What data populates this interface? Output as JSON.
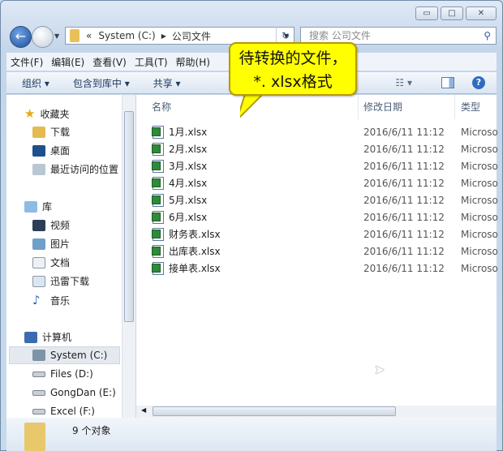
{
  "window": {
    "controls": [
      "minimize",
      "maximize",
      "close"
    ]
  },
  "address": {
    "chevron": "«",
    "crumbs": [
      "System (C:)",
      "公司文件"
    ]
  },
  "search": {
    "placeholder": "搜索 公司文件"
  },
  "menu": [
    "文件(F)",
    "编辑(E)",
    "查看(V)",
    "工具(T)",
    "帮助(H)"
  ],
  "toolbar": {
    "organize": "组织",
    "include": "包含到库中",
    "share": "共享"
  },
  "nav": {
    "favorites": "收藏夹",
    "fav_items": [
      "下载",
      "桌面",
      "最近访问的位置"
    ],
    "libraries": "库",
    "lib_items": [
      "视频",
      "图片",
      "文档",
      "迅雷下载",
      "音乐"
    ],
    "computer": "计算机",
    "drives": [
      "System (C:)",
      "Files (D:)",
      "GongDan (E:)",
      "Excel (F:)"
    ]
  },
  "columns": {
    "name": "名称",
    "modified": "修改日期",
    "type": "类型"
  },
  "files": [
    {
      "name": "1月.xlsx",
      "modified": "2016/6/11 11:12",
      "type": "Microso"
    },
    {
      "name": "2月.xlsx",
      "modified": "2016/6/11 11:12",
      "type": "Microso"
    },
    {
      "name": "3月.xlsx",
      "modified": "2016/6/11 11:12",
      "type": "Microso"
    },
    {
      "name": "4月.xlsx",
      "modified": "2016/6/11 11:12",
      "type": "Microso"
    },
    {
      "name": "5月.xlsx",
      "modified": "2016/6/11 11:12",
      "type": "Microso"
    },
    {
      "name": "6月.xlsx",
      "modified": "2016/6/11 11:12",
      "type": "Microso"
    },
    {
      "name": "财务表.xlsx",
      "modified": "2016/6/11 11:12",
      "type": "Microso"
    },
    {
      "name": "出库表.xlsx",
      "modified": "2016/6/11 11:12",
      "type": "Microso"
    },
    {
      "name": "接单表.xlsx",
      "modified": "2016/6/11 11:12",
      "type": "Microso"
    }
  ],
  "status": {
    "count": "9 个对象"
  },
  "callout": {
    "line1": "待转换的文件，",
    "line2": "*. xlsx格式"
  }
}
